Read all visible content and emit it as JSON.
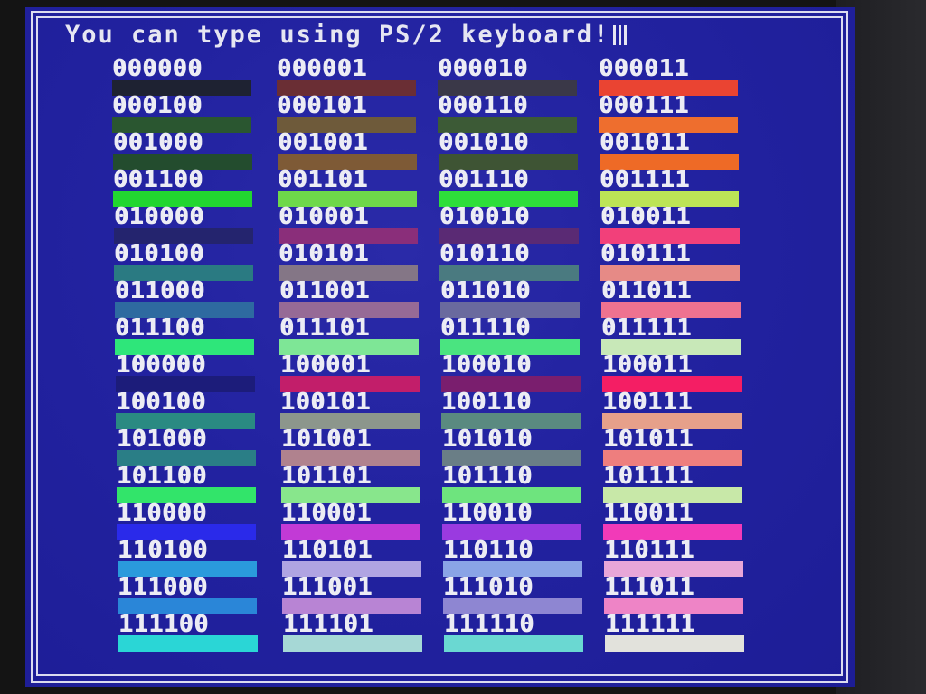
{
  "header": {
    "text": "You can type using PS/2 keyboard!"
  },
  "palette": [
    {
      "code": "000000",
      "color": "#1e2232"
    },
    {
      "code": "000001",
      "color": "#6a2e34"
    },
    {
      "code": "000010",
      "color": "#3a3848"
    },
    {
      "code": "000011",
      "color": "#ea4432"
    },
    {
      "code": "000100",
      "color": "#2a5630"
    },
    {
      "code": "000101",
      "color": "#6e5a3a"
    },
    {
      "code": "000110",
      "color": "#3c5a36"
    },
    {
      "code": "000111",
      "color": "#ee6e2e"
    },
    {
      "code": "001000",
      "color": "#234c2e"
    },
    {
      "code": "001001",
      "color": "#7e5a36"
    },
    {
      "code": "001010",
      "color": "#3e5434"
    },
    {
      "code": "001011",
      "color": "#ee6a26"
    },
    {
      "code": "001100",
      "color": "#22d630"
    },
    {
      "code": "001101",
      "color": "#6ed84a"
    },
    {
      "code": "001110",
      "color": "#2ede3a"
    },
    {
      "code": "001111",
      "color": "#bce456"
    },
    {
      "code": "010000",
      "color": "#24246e"
    },
    {
      "code": "010001",
      "color": "#8a2e7a"
    },
    {
      "code": "010010",
      "color": "#5a2a74"
    },
    {
      "code": "010011",
      "color": "#f2407a"
    },
    {
      "code": "010100",
      "color": "#2a7a82"
    },
    {
      "code": "010101",
      "color": "#847686"
    },
    {
      "code": "010110",
      "color": "#4a7a80"
    },
    {
      "code": "010111",
      "color": "#e68a86"
    },
    {
      "code": "011000",
      "color": "#2e6aa0"
    },
    {
      "code": "011001",
      "color": "#966a96"
    },
    {
      "code": "011010",
      "color": "#6a6a9e"
    },
    {
      "code": "011011",
      "color": "#ee7290"
    },
    {
      "code": "011100",
      "color": "#2ee67a"
    },
    {
      "code": "011101",
      "color": "#7ee696"
    },
    {
      "code": "011110",
      "color": "#4ae480"
    },
    {
      "code": "011111",
      "color": "#c8e8b8"
    },
    {
      "code": "100000",
      "color": "#1c1c7a"
    },
    {
      "code": "100001",
      "color": "#c21e6a"
    },
    {
      "code": "100010",
      "color": "#7a1e6e"
    },
    {
      "code": "100011",
      "color": "#f41e64"
    },
    {
      "code": "100100",
      "color": "#2a8a82"
    },
    {
      "code": "100101",
      "color": "#8c968c"
    },
    {
      "code": "100110",
      "color": "#5a8a80"
    },
    {
      "code": "100111",
      "color": "#e6a08a"
    },
    {
      "code": "101000",
      "color": "#2a7e86"
    },
    {
      "code": "101001",
      "color": "#b0828e"
    },
    {
      "code": "101010",
      "color": "#6a7e86"
    },
    {
      "code": "101011",
      "color": "#ee7e7e"
    },
    {
      "code": "101100",
      "color": "#32e46a"
    },
    {
      "code": "101101",
      "color": "#88e68c"
    },
    {
      "code": "101110",
      "color": "#6ee47e"
    },
    {
      "code": "101111",
      "color": "#c8e8a8"
    },
    {
      "code": "110000",
      "color": "#2a2aea"
    },
    {
      "code": "110001",
      "color": "#c23ad6"
    },
    {
      "code": "110010",
      "color": "#9a3ae0"
    },
    {
      "code": "110011",
      "color": "#f23ab8"
    },
    {
      "code": "110100",
      "color": "#2a9adc"
    },
    {
      "code": "110101",
      "color": "#b0a4e2"
    },
    {
      "code": "110110",
      "color": "#8aa4e6"
    },
    {
      "code": "110111",
      "color": "#e8a6d8"
    },
    {
      "code": "111000",
      "color": "#2a86d8"
    },
    {
      "code": "111001",
      "color": "#b884d4"
    },
    {
      "code": "111010",
      "color": "#8e86d2"
    },
    {
      "code": "111011",
      "color": "#ee84c6"
    },
    {
      "code": "111100",
      "color": "#2ad6d6"
    },
    {
      "code": "111101",
      "color": "#a6d8d6"
    },
    {
      "code": "111110",
      "color": "#6ad8d2"
    },
    {
      "code": "111111",
      "color": "#e2e2dc"
    }
  ]
}
